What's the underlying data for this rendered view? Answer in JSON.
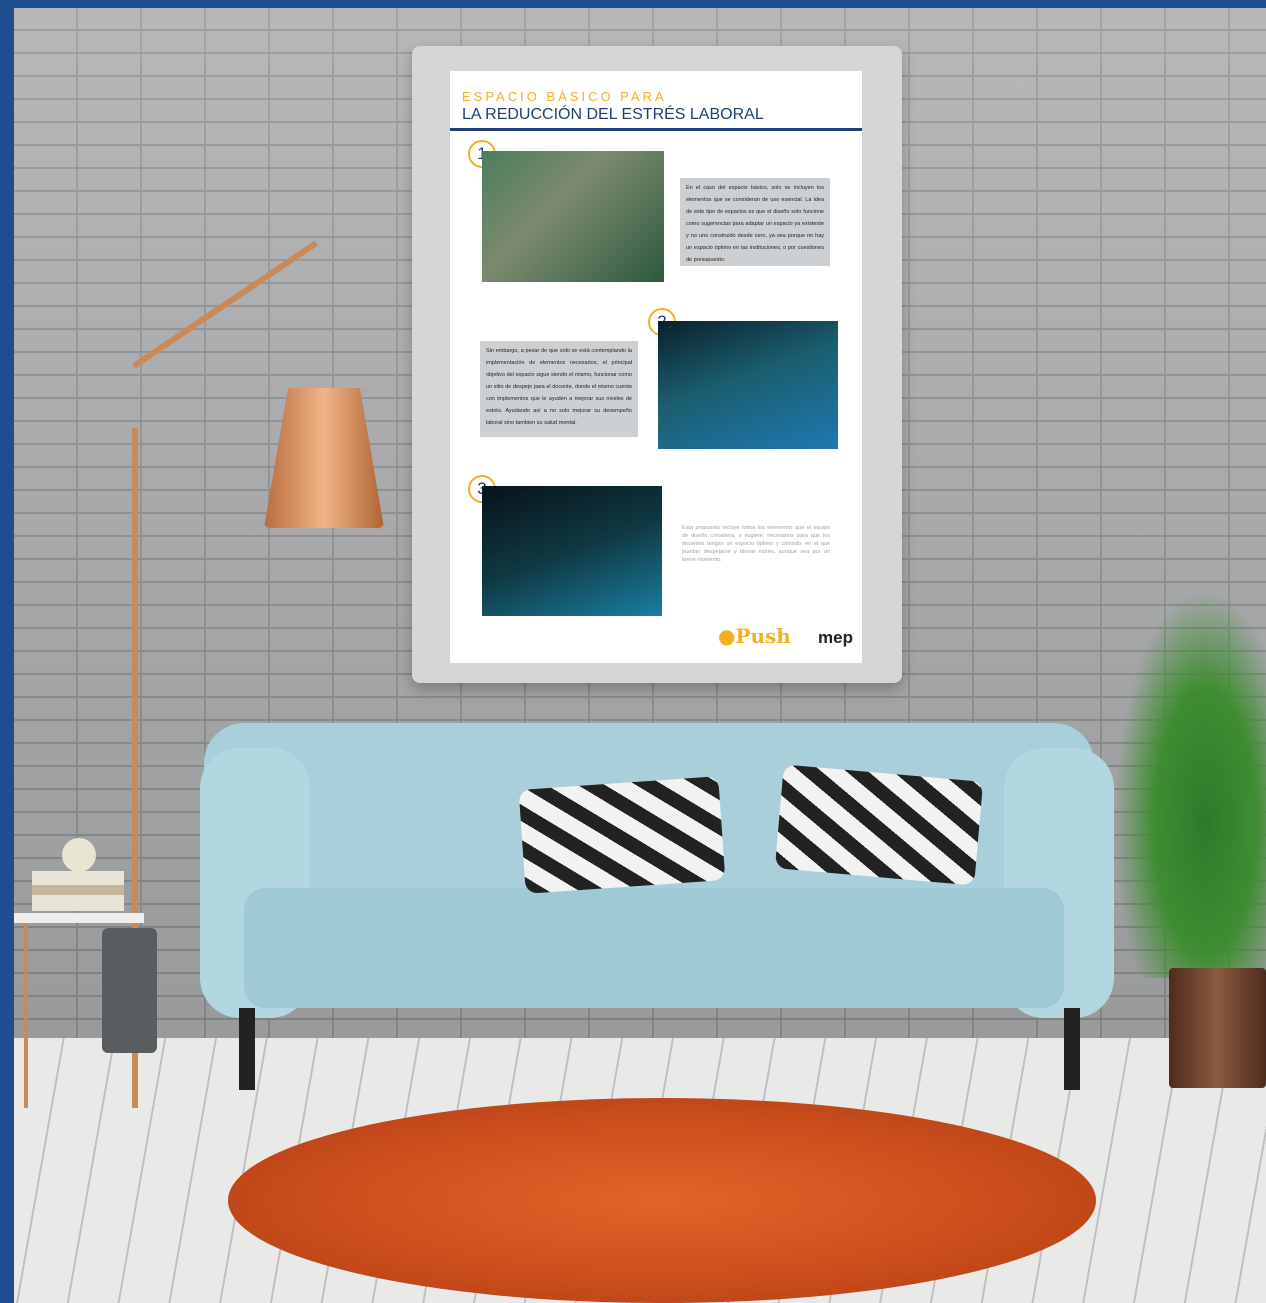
{
  "poster": {
    "supertitle": "ESPACIO BÁSICO PARA",
    "title": "LA REDUCCIÓN DEL ESTRÉS LABORAL",
    "sections": [
      {
        "number": "1",
        "text": "En el caso del espacio básico, solo se incluyen los elementos que se consideran de uso esencial. La idea de este tipo de espacios es que el diseño solo funcione como sugerencias para adaptar un espacio ya existente y no uno construido desde cero, ya sea porque no hay un espacio óptimo en las instituciones, o por cuestiones de presupuesto."
      },
      {
        "number": "2",
        "text": "Sin embargo, a pesar de que solo se está contemplando la implementación de elementos necesarios, el principal objetivo del espacio sigue siendo el mismo, funcionar como un sitio de despeje para el docente, donde el mismo cuente con implementos que le ayuden a mejorar sus niveles de estrés. Ayudando así a no solo mejorar su desempeño laboral sino tambien su salud mental."
      },
      {
        "number": "3",
        "text": "Esta propuesta incluye todos los elementos que el equipo de diseño considera, o sugiere, necesarios para que los docentes tengan un espacio óptimo y cómodo, en el que puedan despejarse y liberar estrés, aunque sea por un breve momento."
      }
    ],
    "logos": {
      "push": "Push",
      "mep": "mep"
    }
  },
  "colors": {
    "border": "#1e4f8c",
    "accent": "#f0b020",
    "title": "#1d3f73"
  }
}
